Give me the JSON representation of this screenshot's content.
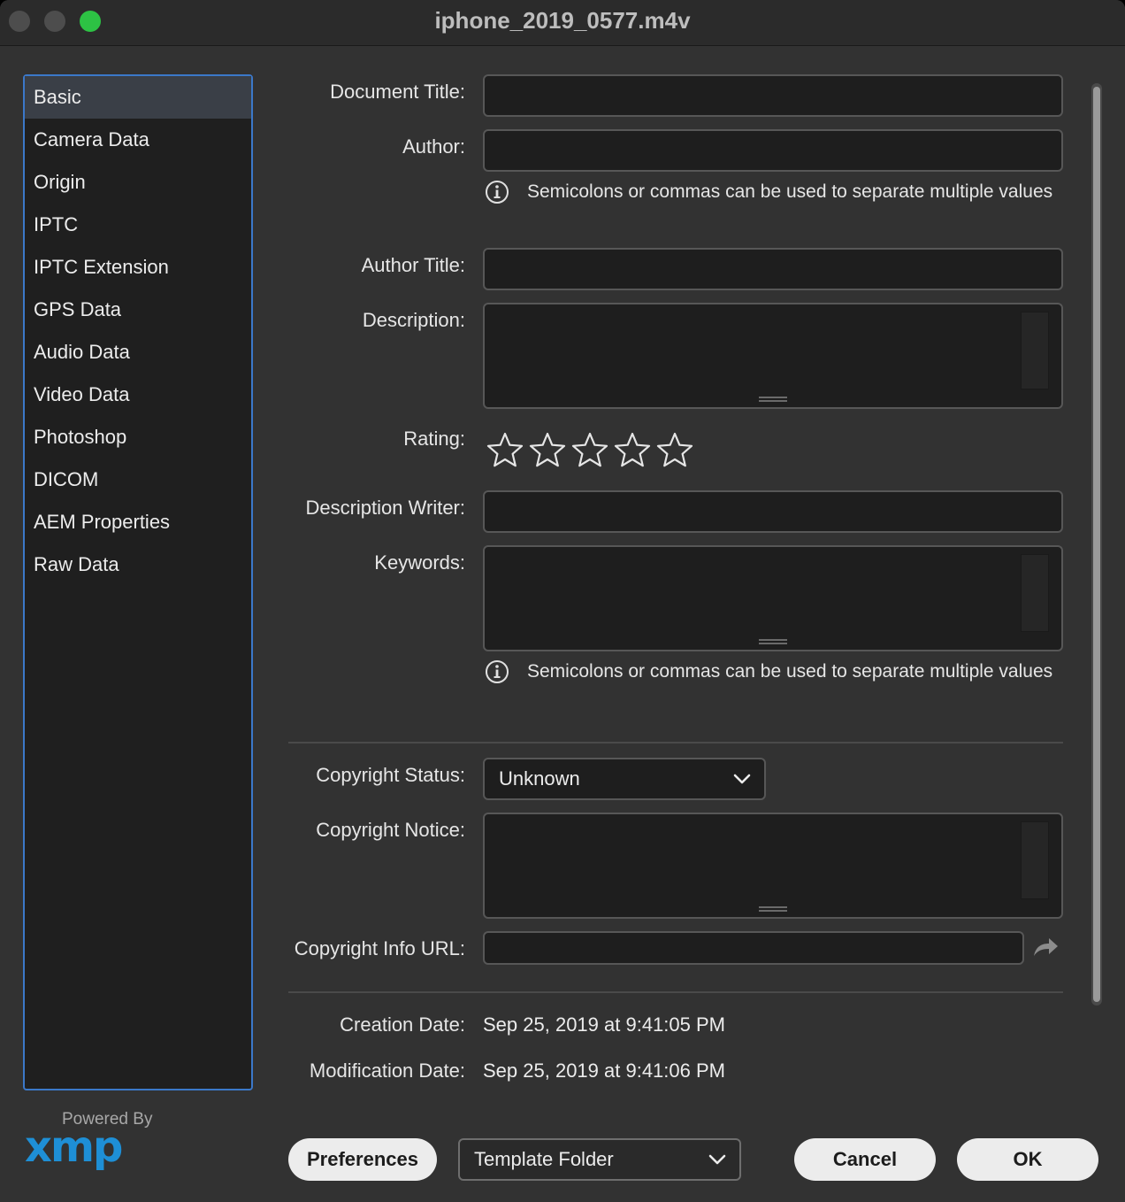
{
  "window": {
    "title": "iphone_2019_0577.m4v"
  },
  "sidebar": {
    "items": [
      {
        "label": "Basic",
        "selected": true
      },
      {
        "label": "Camera Data"
      },
      {
        "label": "Origin"
      },
      {
        "label": "IPTC"
      },
      {
        "label": "IPTC Extension"
      },
      {
        "label": "GPS Data"
      },
      {
        "label": "Audio Data"
      },
      {
        "label": "Video Data"
      },
      {
        "label": "Photoshop"
      },
      {
        "label": "DICOM"
      },
      {
        "label": "AEM Properties"
      },
      {
        "label": "Raw Data"
      }
    ]
  },
  "branding": {
    "powered_by": "Powered By",
    "logo": "xmp"
  },
  "form": {
    "document_title_label": "Document Title:",
    "document_title_value": "",
    "author_label": "Author:",
    "author_value": "",
    "author_hint": "Semicolons or commas can be used to separate multiple values",
    "author_title_label": "Author Title:",
    "author_title_value": "",
    "description_label": "Description:",
    "description_value": "",
    "rating_label": "Rating:",
    "rating_value": 0,
    "rating_max": 5,
    "description_writer_label": "Description Writer:",
    "description_writer_value": "",
    "keywords_label": "Keywords:",
    "keywords_value": "",
    "keywords_hint": "Semicolons or commas can be used to separate multiple values",
    "copyright_status_label": "Copyright Status:",
    "copyright_status_value": "Unknown",
    "copyright_notice_label": "Copyright Notice:",
    "copyright_notice_value": "",
    "copyright_url_label": "Copyright Info URL:",
    "copyright_url_value": "",
    "creation_date_label": "Creation Date:",
    "creation_date_value": "Sep 25, 2019 at 9:41:05 PM",
    "modification_date_label": "Modification Date:",
    "modification_date_value": "Sep 25, 2019 at 9:41:06 PM"
  },
  "footer": {
    "preferences_label": "Preferences",
    "template_folder_label": "Template Folder",
    "cancel_label": "Cancel",
    "ok_label": "OK"
  },
  "colors": {
    "accent_selection": "#3b78c9",
    "zoom_button": "#2dc244",
    "xmp_logo": "#1e8fd6"
  }
}
